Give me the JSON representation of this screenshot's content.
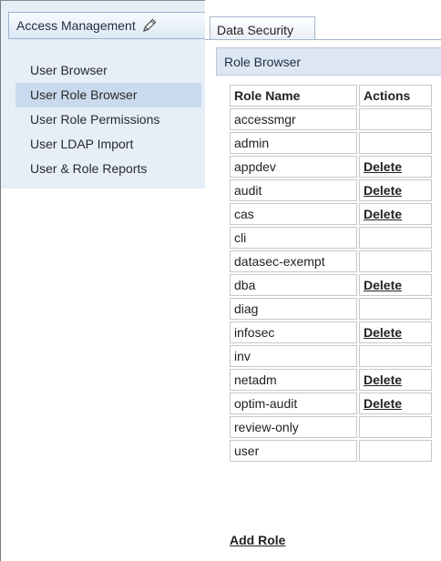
{
  "sidebar": {
    "tab_label": "Access Management",
    "items": [
      {
        "label": "User Browser"
      },
      {
        "label": "User Role Browser"
      },
      {
        "label": "User Role Permissions"
      },
      {
        "label": "User LDAP Import"
      },
      {
        "label": "User & Role Reports"
      }
    ]
  },
  "tabs": [
    {
      "label": "Data Security"
    }
  ],
  "panel": {
    "title": "Role Browser",
    "columns": [
      "Role Name",
      "Actions"
    ],
    "rows": [
      {
        "name": "accessmgr",
        "action": ""
      },
      {
        "name": "admin",
        "action": ""
      },
      {
        "name": "appdev",
        "action": "Delete"
      },
      {
        "name": "audit",
        "action": "Delete"
      },
      {
        "name": "cas",
        "action": "Delete"
      },
      {
        "name": "cli",
        "action": ""
      },
      {
        "name": "datasec-exempt",
        "action": ""
      },
      {
        "name": "dba",
        "action": "Delete"
      },
      {
        "name": "diag",
        "action": ""
      },
      {
        "name": "infosec",
        "action": "Delete"
      },
      {
        "name": "inv",
        "action": ""
      },
      {
        "name": "netadm",
        "action": "Delete"
      },
      {
        "name": "optim-audit",
        "action": "Delete"
      },
      {
        "name": "review-only",
        "action": ""
      },
      {
        "name": "user",
        "action": ""
      }
    ],
    "add_label": "Add Role"
  },
  "icons": {
    "edit": "pencil-icon"
  }
}
